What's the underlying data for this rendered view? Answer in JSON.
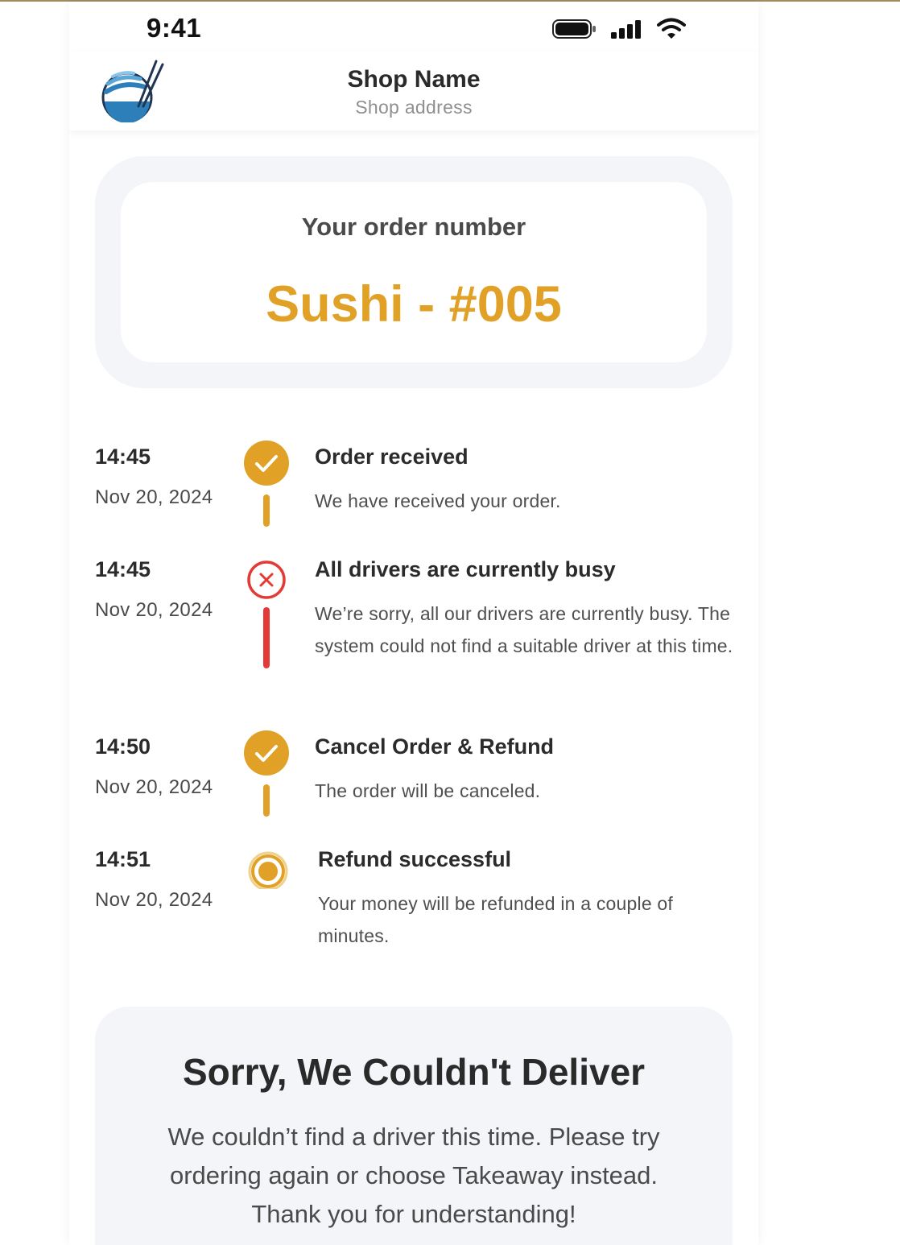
{
  "status_bar": {
    "time": "9:41",
    "icons": [
      "battery-icon",
      "cellular-signal-icon",
      "wifi-icon"
    ]
  },
  "header": {
    "logo": "sushi-bowl-logo",
    "shop_name": "Shop Name",
    "shop_address": "Shop address"
  },
  "order": {
    "label": "Your order number",
    "number": "Sushi - #005"
  },
  "colors": {
    "accent": "#e0a126",
    "error": "#e53935",
    "card_bg": "#f3f5f9"
  },
  "timeline": [
    {
      "time": "14:45",
      "date": "Nov 20, 2024",
      "status": "done",
      "icon": "check-circle-icon",
      "title": "Order received",
      "description": "We have received your order."
    },
    {
      "time": "14:45",
      "date": "Nov 20, 2024",
      "status": "error",
      "icon": "x-circle-icon",
      "title": "All drivers are currently busy",
      "description": "We’re sorry, all our drivers are currently busy. The system could not find a suitable driver at this time."
    },
    {
      "time": "14:50",
      "date": "Nov 20, 2024",
      "status": "done",
      "icon": "check-circle-icon",
      "title": "Cancel Order & Refund",
      "description": "The order will be canceled."
    },
    {
      "time": "14:51",
      "date": "Nov 20, 2024",
      "status": "current",
      "icon": "radio-dot-icon",
      "title": "Refund successful",
      "description": "Your money will be refunded in a couple of minutes."
    }
  ],
  "notice": {
    "title": "Sorry, We Couldn't Deliver",
    "message": "We couldn’t find a driver this time. Please try ordering again or choose Takeaway instead. Thank you for understanding!"
  }
}
